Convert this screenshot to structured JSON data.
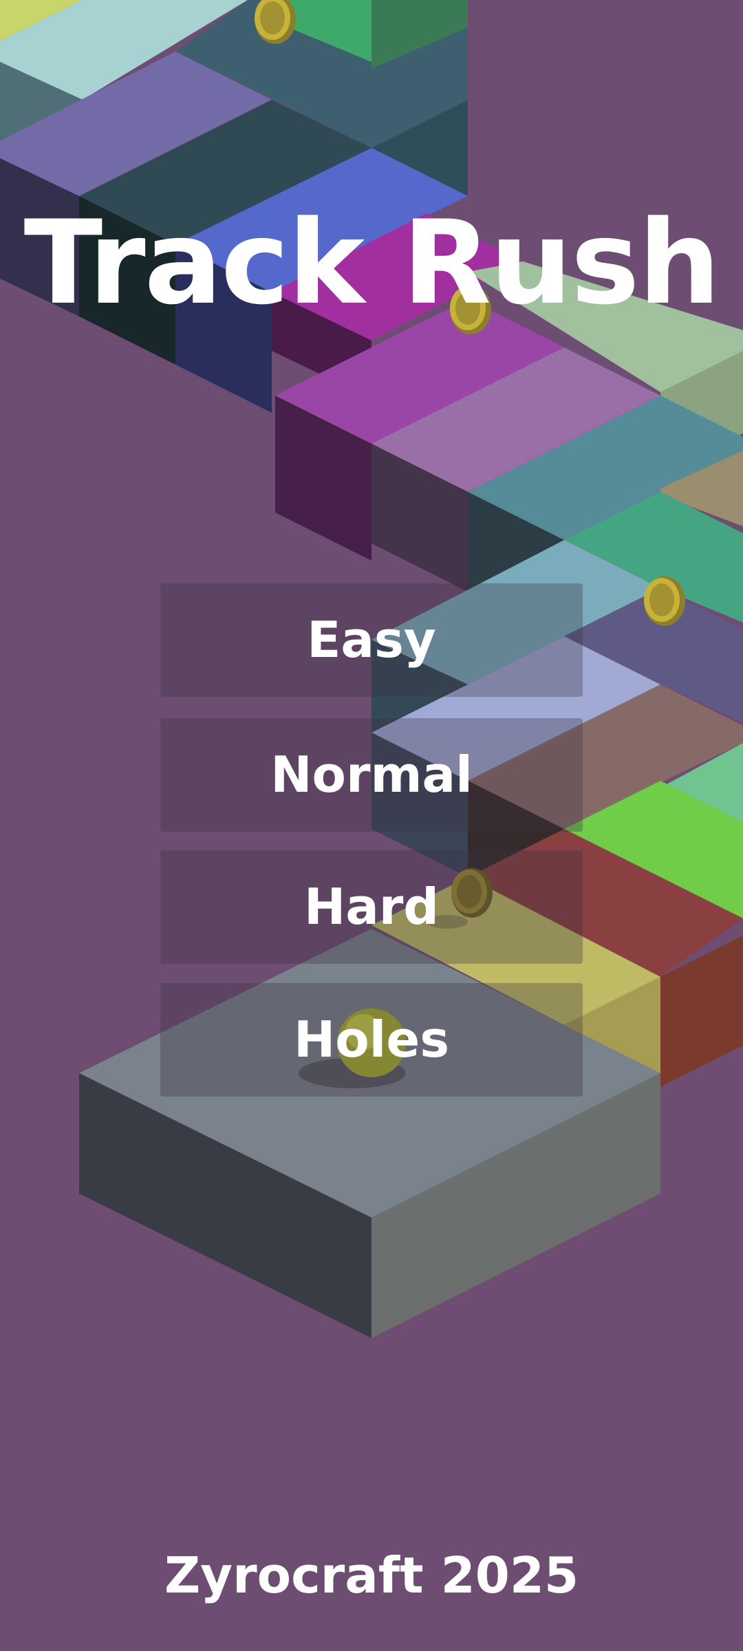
{
  "game": {
    "title": "Track Rush",
    "footer": "Zyrocraft 2025"
  },
  "menu": {
    "buttons": [
      {
        "label": "Easy"
      },
      {
        "label": "Normal"
      },
      {
        "label": "Hard"
      },
      {
        "label": "Holes"
      }
    ]
  },
  "colors": {
    "background": "#6e4d73",
    "text": "#ffffff",
    "ball": "#d4d03a",
    "coin": "#c9b23a"
  }
}
